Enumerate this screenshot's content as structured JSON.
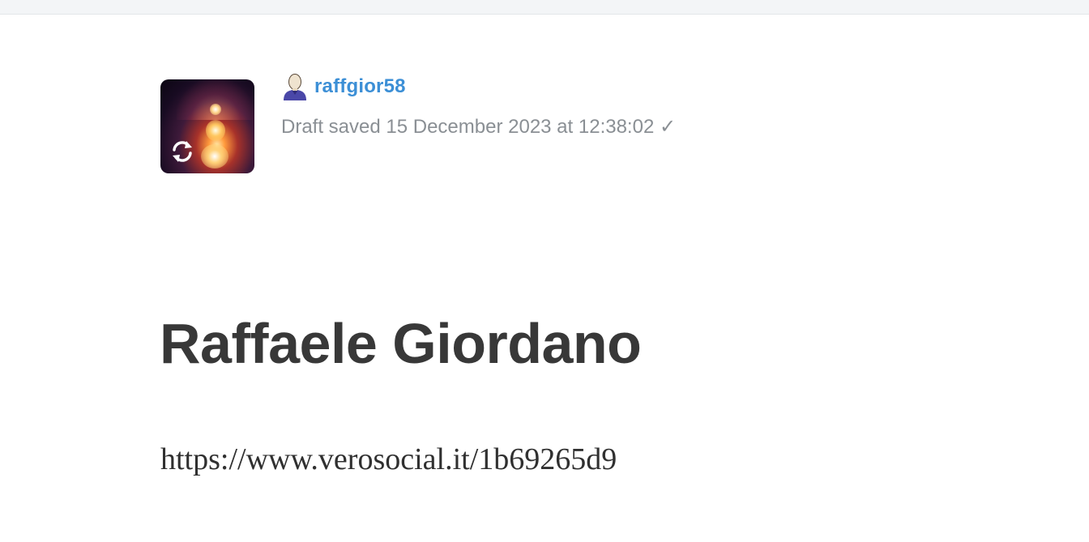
{
  "header": {
    "username": "raffgior58",
    "draft_status": "Draft saved 15 December 2023 at 12:38:02 ✓"
  },
  "avatar": {
    "icon": "sync-icon"
  },
  "post": {
    "title": "Raffaele Giordano",
    "body": "https://www.verosocial.it/1b69265d9"
  },
  "colors": {
    "username": "#3c8fd6",
    "status": "#8a8f94",
    "title": "#383838",
    "body": "#303030"
  }
}
